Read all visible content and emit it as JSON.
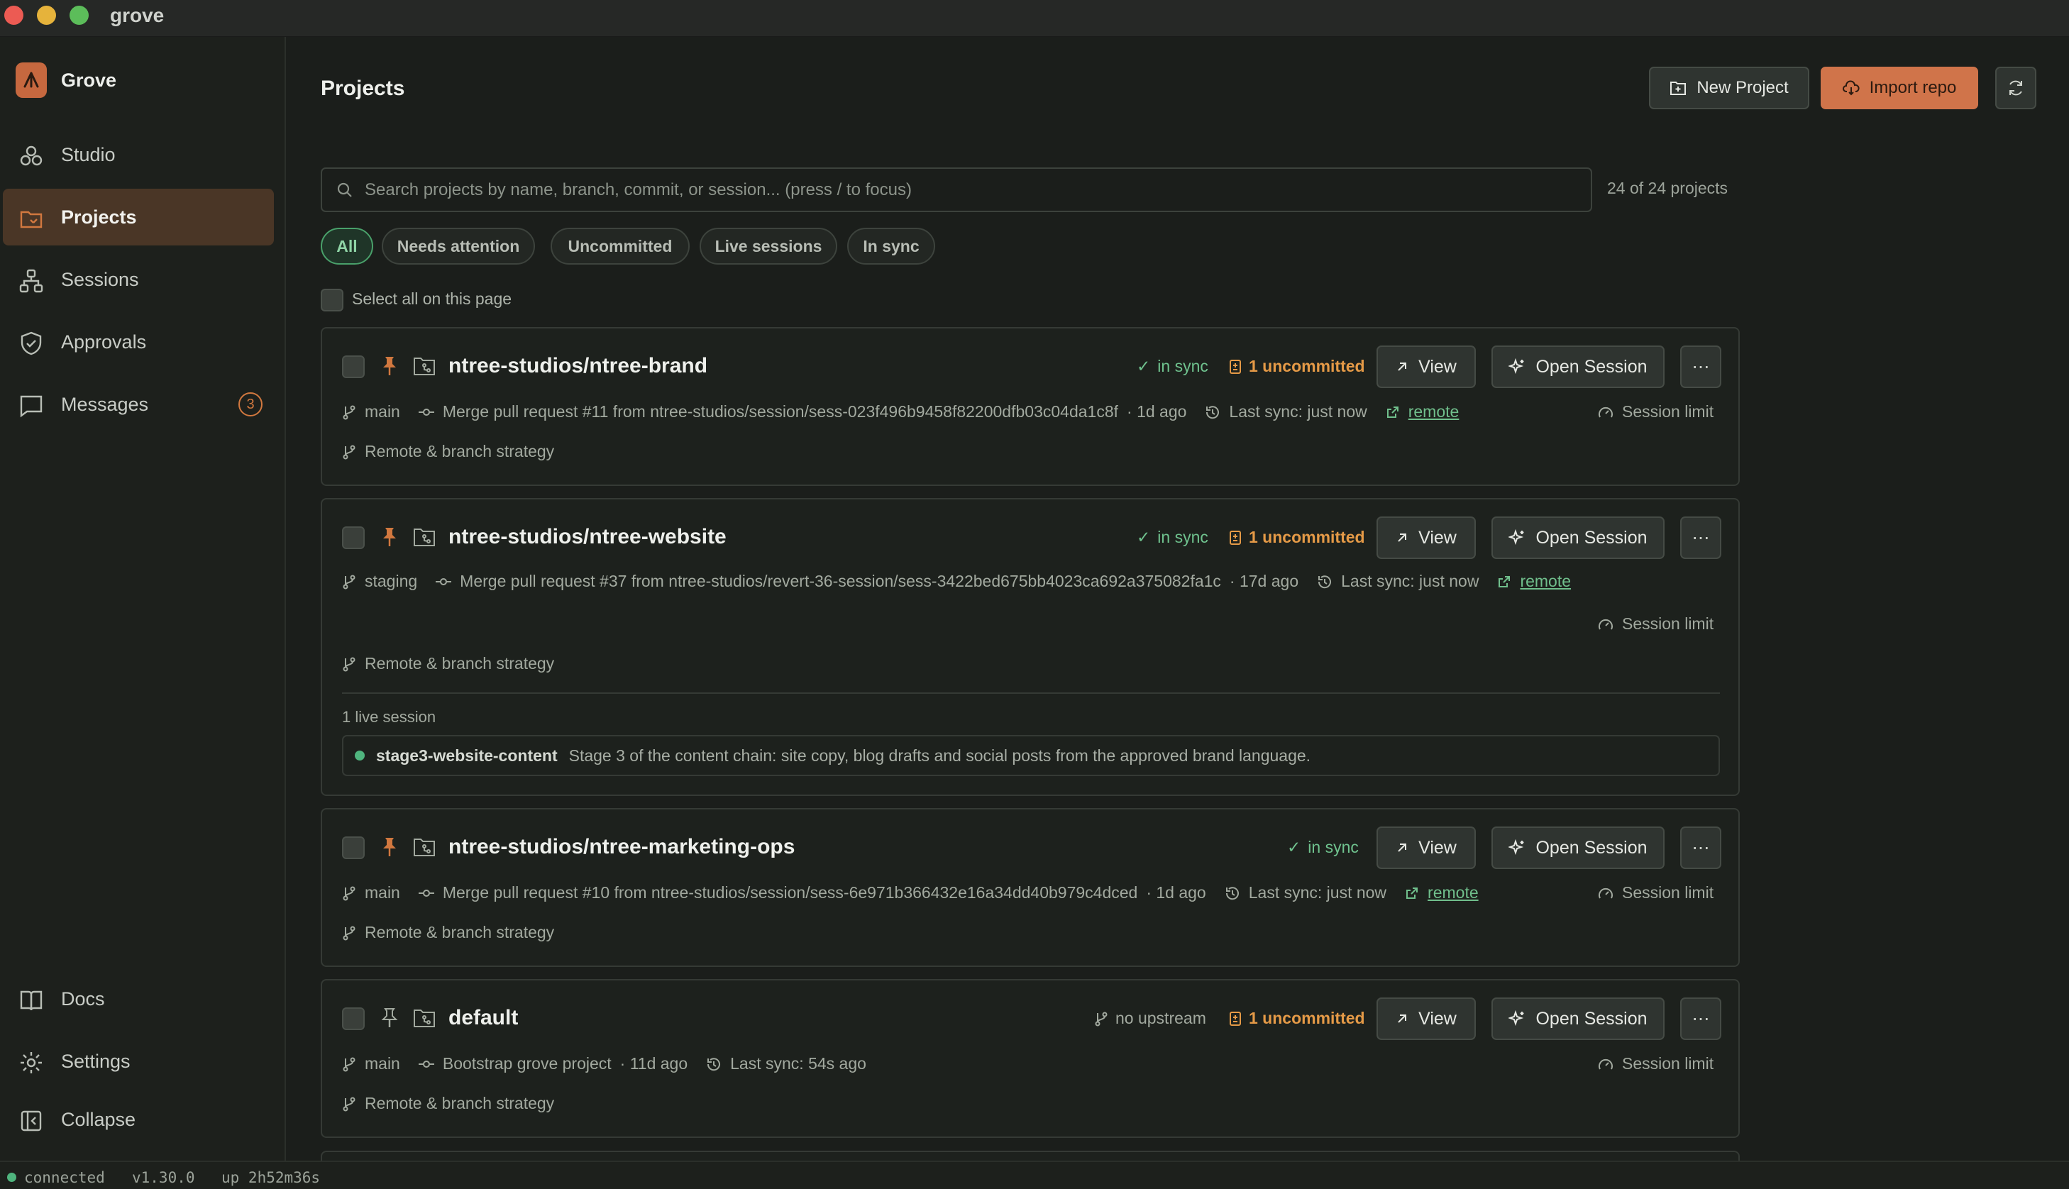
{
  "window": {
    "title": "grove"
  },
  "sidebar": {
    "brand": "Grove",
    "items": [
      {
        "label": "Studio",
        "icon": "studio-icon"
      },
      {
        "label": "Projects",
        "icon": "projects-icon",
        "active": true
      },
      {
        "label": "Sessions",
        "icon": "sessions-icon"
      },
      {
        "label": "Approvals",
        "icon": "shield-icon"
      },
      {
        "label": "Messages",
        "icon": "message-icon",
        "badge": "3"
      }
    ],
    "bottom": [
      {
        "label": "Docs",
        "icon": "book-icon"
      },
      {
        "label": "Settings",
        "icon": "gear-icon"
      },
      {
        "label": "Collapse",
        "icon": "collapse-icon"
      }
    ]
  },
  "header": {
    "title": "Projects",
    "new_project": "New Project",
    "import_repo": "Import repo"
  },
  "search": {
    "placeholder": "Search projects by name, branch, commit, or session... (press / to focus)",
    "count": "24 of 24 projects"
  },
  "filters": [
    "All",
    "Needs attention",
    "Uncommitted",
    "Live sessions",
    "In sync"
  ],
  "select_all": "Select all on this page",
  "actions": {
    "view": "View",
    "open_session": "Open Session",
    "more": "⋯"
  },
  "projects": [
    {
      "name": "ntree-studios/ntree-brand",
      "sync": "in sync",
      "uncommitted": "1 uncommitted",
      "branch": "main",
      "commit": "Merge pull request #11 from ntree-studios/session/sess-023f496b9458f82200dfb03c04da1c8f",
      "age": "· 1d ago",
      "last_sync": "Last sync: just now",
      "remote": "remote",
      "session_limit": "Session limit",
      "strategy": "Remote & branch strategy"
    },
    {
      "name": "ntree-studios/ntree-website",
      "sync": "in sync",
      "uncommitted": "1 uncommitted",
      "branch": "staging",
      "commit": "Merge pull request #37 from ntree-studios/revert-36-session/sess-3422bed675bb4023ca692a375082fa1c",
      "age": "· 17d ago",
      "last_sync": "Last sync: just now",
      "remote": "remote",
      "session_limit": "Session limit",
      "strategy": "Remote & branch strategy",
      "live_label": "1 live session",
      "live_session_name": "stage3-website-content",
      "live_session_desc": "Stage 3 of the content chain: site copy, blog drafts and social posts from the approved brand language."
    },
    {
      "name": "ntree-studios/ntree-marketing-ops",
      "sync": "in sync",
      "branch": "main",
      "commit": "Merge pull request #10 from ntree-studios/session/sess-6e971b366432e16a34dd40b979c4dced",
      "age": "· 1d ago",
      "last_sync": "Last sync: just now",
      "remote": "remote",
      "session_limit": "Session limit",
      "strategy": "Remote & branch strategy"
    },
    {
      "name": "default",
      "sync": "no upstream",
      "uncommitted": "1 uncommitted",
      "branch": "main",
      "commit": "Bootstrap grove project",
      "age": "· 11d ago",
      "last_sync": "Last sync: 54s ago",
      "session_limit": "Session limit",
      "strategy": "Remote & branch strategy"
    }
  ],
  "statusbar": {
    "state": "connected",
    "version": "v1.30.0",
    "uptime": "up 2h52m36s"
  },
  "colors": {
    "accent": "#d0744a",
    "sync_green": "#6fc28e",
    "uncommitted_orange": "#e59a47",
    "active_nav": "#4a3626"
  }
}
